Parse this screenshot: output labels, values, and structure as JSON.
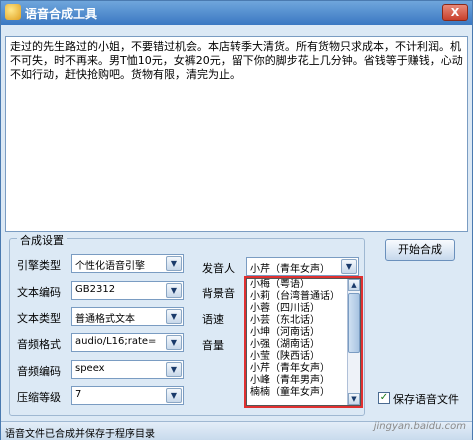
{
  "window": {
    "title": "语音合成工具",
    "close_label": "X"
  },
  "editor": {
    "text": "走过的先生路过的小姐，不要错过机会。本店转季大清货。所有货物只求成本，不计利润。机不可失，时不再来。男T恤10元，女裤20元，留下你的脚步花上几分钟。省钱等于赚钱，心动不如行动，赶快抢购吧。货物有限，清完为止。"
  },
  "settings": {
    "group_title": "合成设置",
    "engine": {
      "label": "引擎类型",
      "value": "个性化语音引擎"
    },
    "text_encoding": {
      "label": "文本编码",
      "value": "GB2312"
    },
    "text_type": {
      "label": "文本类型",
      "value": "普通格式文本"
    },
    "audio_format": {
      "label": "音频格式",
      "value": "audio/L16;rate="
    },
    "audio_encoding": {
      "label": "音频编码",
      "value": "speex"
    },
    "compression": {
      "label": "压缩等级",
      "value": "7"
    },
    "voice": {
      "label": "发音人",
      "value": "小芹（青年女声）"
    },
    "background": {
      "label": "背景音"
    },
    "speed": {
      "label": "语速"
    },
    "volume": {
      "label": "音量"
    }
  },
  "voice_options": [
    "小梅（粤语）",
    "小莉（台湾普通话）",
    "小蓉（四川话）",
    "小芸（东北话）",
    "小坤（河南话）",
    "小强（湖南话）",
    "小莹（陕西话）",
    "小芹（青年女声）",
    "小峰（青年男声）",
    "楠楠（童年女声）"
  ],
  "start_button": "开始合成",
  "save_checkbox": {
    "label": "保存语音文件",
    "checked": true
  },
  "status": "语音文件已合成并保存于程序目录",
  "watermark": "jingyan.baidu.com"
}
